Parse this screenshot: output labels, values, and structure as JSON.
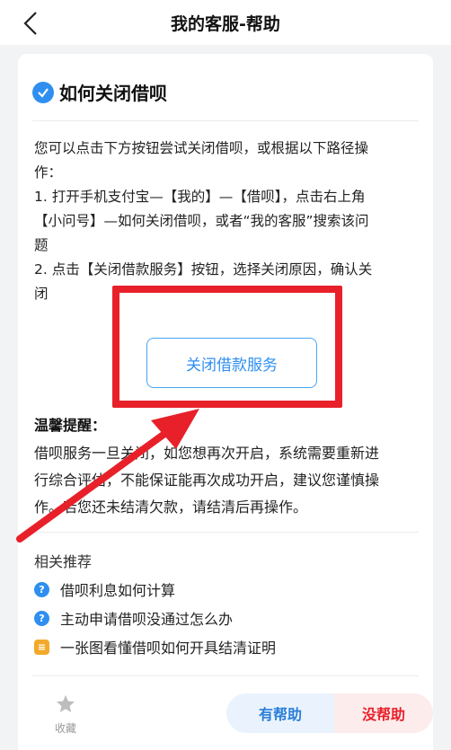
{
  "header": {
    "title": "我的客服-帮助",
    "back_icon": "chevron-left-icon"
  },
  "question": {
    "title": "如何关闭借呗",
    "icon": "check-circle-icon",
    "accent": "#2f8ff0",
    "lines": [
      "您可以点击下方按钮尝试关闭借呗，或根据以下路径操",
      "作：",
      "1. 打开手机支付宝—【我的】—【借呗】，点击右上角",
      "【小问号】—如何关闭借呗，或者“我的客服”搜索该问",
      "题",
      "2. 点击【关闭借款服务】按钮，选择关闭原因，确认关",
      "闭"
    ]
  },
  "action": {
    "close_label": "关闭借款服务"
  },
  "tip": {
    "title": "温馨提醒：",
    "lines": [
      "借呗服务一旦关闭，如您想再次开启，系统需要重新进",
      "行综合评估，不能保证能再次成功开启，建议您谨慎操",
      "作。若您还未结清欠款，请结清后再操作。"
    ]
  },
  "related": {
    "title": "相关推荐",
    "items": [
      {
        "label": "借呗利息如何计算",
        "icon": "question-icon",
        "color": "#2f8ff0"
      },
      {
        "label": "主动申请借呗没通过怎么办",
        "icon": "question-icon",
        "color": "#2f8ff0"
      },
      {
        "label": "一张图看懂借呗如何开具结清证明",
        "icon": "document-icon",
        "color": "#f2a92a"
      }
    ]
  },
  "footer": {
    "favorite_label": "收藏",
    "helpful_label": "有帮助",
    "unhelpful_label": "没帮助"
  },
  "annotation_color": "#e8202a"
}
